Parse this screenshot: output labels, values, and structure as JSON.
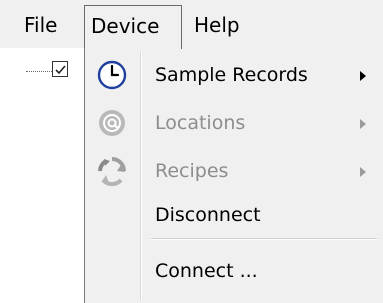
{
  "menubar": {
    "items": [
      {
        "label": "File"
      },
      {
        "label": "Device"
      },
      {
        "label": "Help"
      }
    ]
  },
  "dropdown": {
    "items": [
      {
        "label": "Sample Records",
        "icon": "clock-icon",
        "enabled": true,
        "has_submenu": true
      },
      {
        "label": "Locations",
        "icon": "at-sign-icon",
        "enabled": false,
        "has_submenu": true
      },
      {
        "label": "Recipes",
        "icon": "recycle-icon",
        "enabled": false,
        "has_submenu": true
      },
      {
        "label": "Disconnect",
        "enabled": true,
        "has_submenu": false
      },
      {
        "label": "Connect ...",
        "enabled": true,
        "has_submenu": false
      }
    ]
  },
  "tree": {
    "checkbox_checked": true
  },
  "colors": {
    "menu_bg": "#f0f0f0",
    "disabled_text": "#8d8d8d",
    "clock_blue": "#1f3f9f"
  }
}
